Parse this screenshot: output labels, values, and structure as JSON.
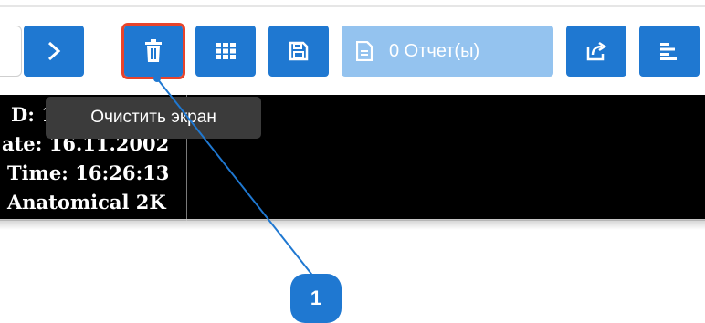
{
  "toolbar": {
    "buttons": [
      {
        "name": "next-button",
        "icon": "chevron-right-icon"
      },
      {
        "name": "clear-screen-button",
        "icon": "trash-icon"
      },
      {
        "name": "grid-layout-button",
        "icon": "grid-icon"
      },
      {
        "name": "save-button",
        "icon": "save-icon"
      },
      {
        "name": "report-button",
        "icon": "document-icon",
        "label": "0 Отчет(ы)"
      },
      {
        "name": "share-button",
        "icon": "share-icon"
      },
      {
        "name": "align-left-button",
        "icon": "align-left-icon"
      }
    ],
    "colors": {
      "button": "#1f78d1",
      "button_disabled": "#94c3ef",
      "highlight": "#e8442b"
    }
  },
  "tooltip": {
    "text": "Очистить экран"
  },
  "viewer": {
    "info_lines": [
      "D: 1",
      "ate: 16.11.2002",
      "Time: 16:26:13",
      "Anatomical 2K"
    ]
  },
  "callout": {
    "number": "1"
  }
}
